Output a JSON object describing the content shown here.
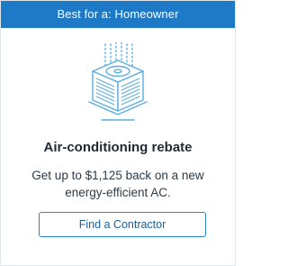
{
  "card": {
    "header": "Best for a: Homeowner",
    "illustration_icon": "air-conditioner-unit-icon",
    "title": "Air-conditioning rebate",
    "description": "Get up to $1,125 back on a new energy-efficient AC.",
    "button_label": "Find a Contractor"
  },
  "colors": {
    "header_background": "#1e79c7",
    "header_text": "#ffffff",
    "icon_stroke": "#5aaee0",
    "button_border": "#2f86c9",
    "button_text": "#1b5f99"
  }
}
